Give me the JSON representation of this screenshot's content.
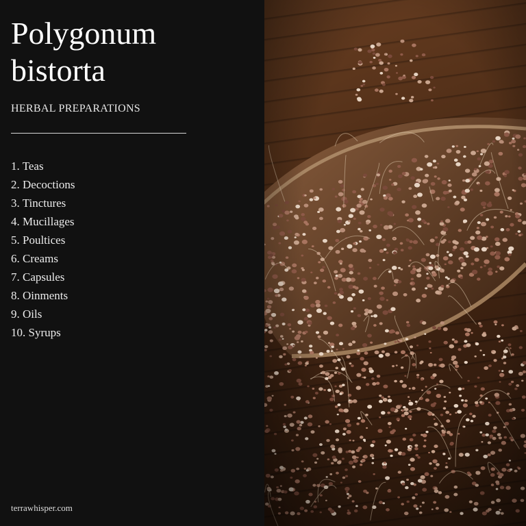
{
  "title_lines": [
    "Polygonum",
    "bistorta"
  ],
  "subtitle": "HERBAL PREPARATIONS",
  "preparations": [
    "1. Teas",
    "2. Decoctions",
    "3. Tinctures",
    "4. Mucillages",
    "5. Poultices",
    "6. Creams",
    "7. Capsules",
    "8. Oinments",
    "9. Oils",
    "10. Syrups"
  ],
  "footer": "terrawhisper.com",
  "photo": {
    "subject": "dried bistort seeds in wooden bowl on wooden table",
    "colors": {
      "wood": "#5a3419",
      "seed": "#9a6a58",
      "bowl_rim": "#8a6a4c",
      "stem": "#d9c2a8"
    }
  }
}
